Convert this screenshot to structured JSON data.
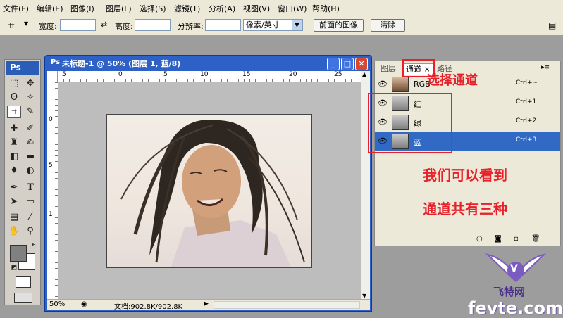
{
  "menu": [
    "文件(F)",
    "编辑(E)",
    "图像(I)",
    "图层(L)",
    "选择(S)",
    "滤镜(T)",
    "分析(A)",
    "视图(V)",
    "窗口(W)",
    "帮助(H)"
  ],
  "options": {
    "width_label": "宽度:",
    "height_label": "高度:",
    "resolution_label": "分辨率:",
    "unit_value": "像素/英寸",
    "front_image_button": "前面的图像",
    "clear_button": "清除"
  },
  "toolbox": {
    "logo": "Ps"
  },
  "document": {
    "title": "未标题-1 @ 50% (图层 1, 蓝/8)",
    "ruler_ticks": [
      "5",
      "0",
      "5",
      "10",
      "15",
      "20",
      "25"
    ],
    "ruler_left_ticks": [
      "0",
      "5",
      "1"
    ],
    "zoom": "50%",
    "doc_info": "文档:902.8K/902.8K"
  },
  "panel": {
    "tabs": [
      "图层",
      "通道 ×",
      "路径"
    ],
    "channels": [
      {
        "name": "RGB",
        "shortcut": "Ctrl+~",
        "selected": false
      },
      {
        "name": "红",
        "shortcut": "Ctrl+1",
        "selected": false
      },
      {
        "name": "绿",
        "shortcut": "Ctrl+2",
        "selected": false
      },
      {
        "name": "蓝",
        "shortcut": "Ctrl+3",
        "selected": true
      }
    ],
    "selected_color": "#316ac5"
  },
  "annotations": {
    "select_channels": "选择通道",
    "line1": "我们可以看到",
    "line2": "通道共有三种",
    "color": "#e8202a"
  },
  "watermark": {
    "cn": "飞特网",
    "en": "fevte.com",
    "letter": "V"
  }
}
